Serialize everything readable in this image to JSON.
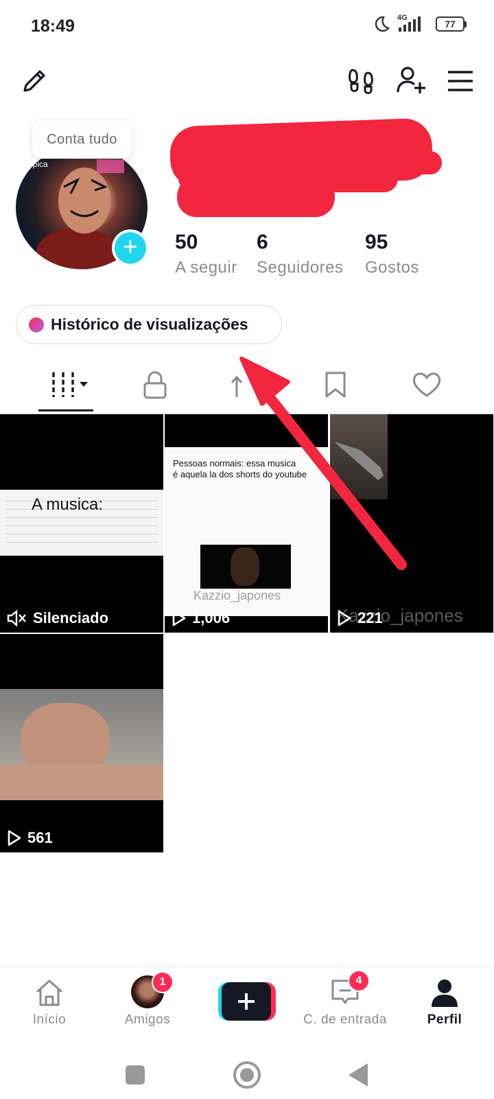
{
  "status_bar": {
    "time": "18:49",
    "network": "4G",
    "battery": "77"
  },
  "top_bar": {
    "icons": [
      "edit-icon",
      "footprints-icon",
      "add-friend-icon",
      "menu-icon"
    ]
  },
  "profile": {
    "bubble_text": "Conta tudo",
    "avatar_caption": "épica",
    "stats": [
      {
        "value": "50",
        "label": "A seguir"
      },
      {
        "value": "6",
        "label": "Seguidores"
      },
      {
        "value": "95",
        "label": "Gostos"
      }
    ],
    "history_button": "Histórico de visualizações"
  },
  "tabs": [
    "videos-tab",
    "private-tab",
    "reposts-tab",
    "favorites-tab",
    "liked-tab"
  ],
  "videos": [
    {
      "count": "Silenciado",
      "type": "muted",
      "overlay_title": "A musica:"
    },
    {
      "count": "1,006",
      "type": "play",
      "overlay_title": "Pessoas normais: essa musica\né aquela la dos shorts do youtube",
      "watermark": "Kazzio_japones"
    },
    {
      "count": "221",
      "type": "play",
      "watermark": "Kazzio_japones"
    },
    {
      "count": "561",
      "type": "play"
    }
  ],
  "bottom_nav": [
    {
      "label": "Início",
      "icon": "home-icon"
    },
    {
      "label": "Amigos",
      "icon": "friends-avatar",
      "badge": "1"
    },
    {
      "label": "",
      "icon": "create-icon"
    },
    {
      "label": "C. de entrada",
      "icon": "inbox-icon",
      "badge": "4"
    },
    {
      "label": "Perfil",
      "icon": "profile-icon"
    }
  ],
  "colors": {
    "accent": "#fe2c55",
    "cyan": "#20d5ec",
    "redaction": "#f2263f",
    "arrow": "#f2263f"
  }
}
